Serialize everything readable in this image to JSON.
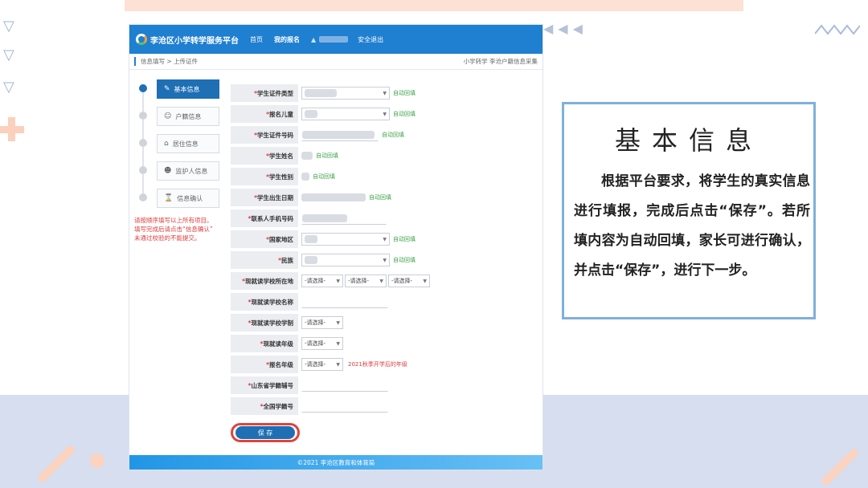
{
  "app": {
    "site_title": "李沧区小学转学服务平台",
    "nav": [
      "首页",
      "我的报名",
      "安全退出"
    ],
    "breadcrumb": "信息填写 > 上传证件",
    "page_context": "小学转学 李沧户籍信息采集"
  },
  "steps": [
    {
      "label": "基本信息",
      "icon": "edit-icon",
      "active": true
    },
    {
      "label": "户籍信息",
      "icon": "person-icon",
      "active": false
    },
    {
      "label": "居住信息",
      "icon": "home-icon",
      "active": false
    },
    {
      "label": "监护人信息",
      "icon": "guardian-icon",
      "active": false
    },
    {
      "label": "信息确认",
      "icon": "hourglass-icon",
      "active": false
    }
  ],
  "side_note": "请按顺序填写以上所有项目。\n填写完成后请点击“信息确认”\n未通过校验的不能提交。",
  "form": {
    "required_mark": "*",
    "auto_fill": "自动回填",
    "select_placeholder": "-请选择-",
    "grade_hint": "2021秋季开学后的年级",
    "labels": {
      "cert_type": "学生证件类型",
      "child": "报名儿童",
      "cert_no": "学生证件号码",
      "name": "学生姓名",
      "gender": "学生性别",
      "birth": "学生出生日期",
      "phone": "联系人手机号码",
      "country": "国家地区",
      "ethnicity": "民族",
      "school_loc": "现就读学校所在地",
      "school_name": "现就读学校名称",
      "school_system": "现就读学校学制",
      "current_grade": "现就读年级",
      "apply_grade": "报名年级",
      "sd_no": "山东省学籍辅号",
      "national_no": "全国学籍号"
    },
    "save_label": "保 存"
  },
  "footer": "©2021  李沧区教育和体育局",
  "panel": {
    "title": "基本信息",
    "body": "根据平台要求，将学生的真实信息进行填报，完成后点击“保存”。若所填内容为自动回填，家长可进行确认，并点击“保存”，进行下一步。"
  },
  "colors": {
    "primary": "#1f7fd0",
    "accent_red": "#e03b3b",
    "auto_green": "#3aa245",
    "panel_border": "#7fb0d9"
  }
}
